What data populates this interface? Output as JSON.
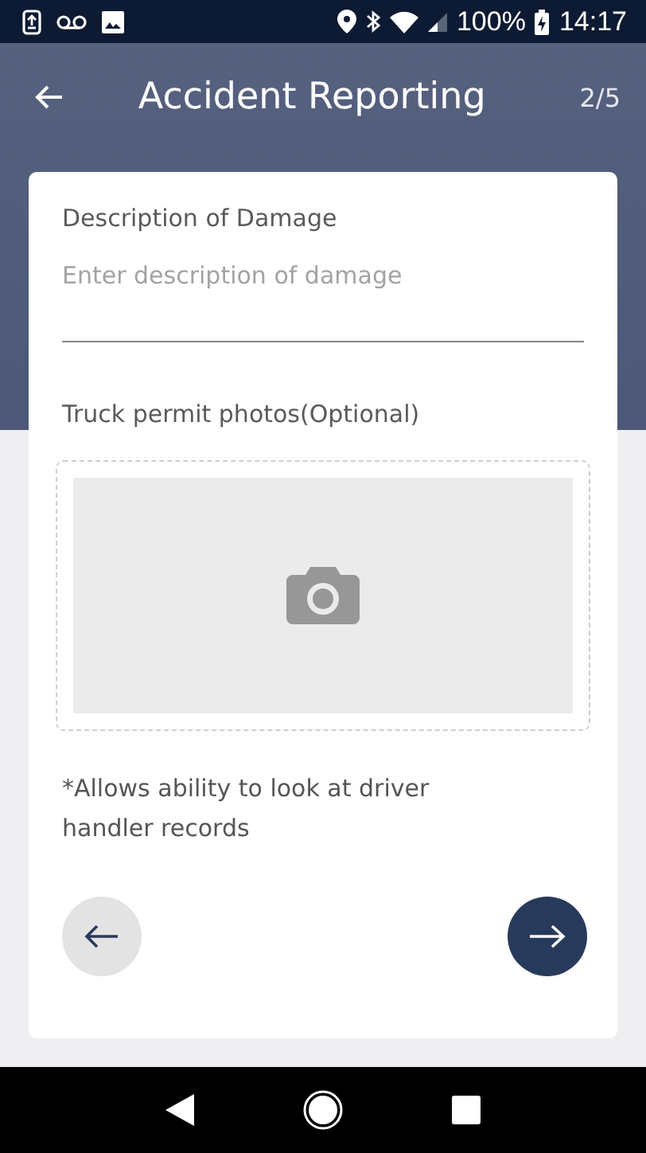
{
  "status_bar": {
    "battery": "100%",
    "time": "14:17"
  },
  "header": {
    "title": "Accident Reporting",
    "step": "2/5"
  },
  "form": {
    "description": {
      "label": "Description of Damage",
      "placeholder": "Enter description of damage"
    },
    "photos": {
      "label": "Truck permit photos(Optional)"
    },
    "note": "*Allows ability to look at driver handler records"
  }
}
